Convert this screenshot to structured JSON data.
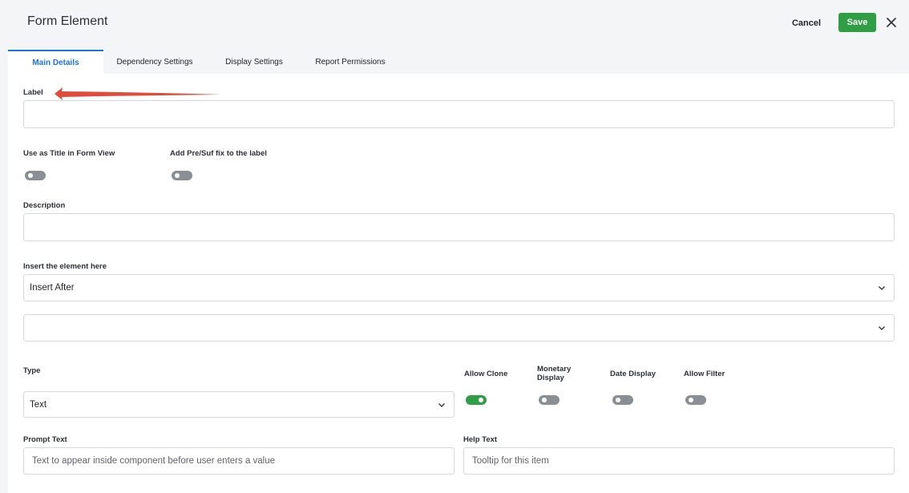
{
  "header": {
    "title": "Form Element",
    "cancel_label": "Cancel",
    "save_label": "Save",
    "close_icon": "close-icon"
  },
  "tabs": [
    {
      "label": "Main Details",
      "active": true
    },
    {
      "label": "Dependency Settings",
      "active": false
    },
    {
      "label": "Display Settings",
      "active": false
    },
    {
      "label": "Report Permissions",
      "active": false
    }
  ],
  "form": {
    "label": {
      "label": "Label",
      "value": ""
    },
    "use_as_title": {
      "label": "Use as Title in Form View",
      "on": false
    },
    "add_prefix_suffix": {
      "label": "Add Pre/Suf fix to the label",
      "on": false
    },
    "description": {
      "label": "Description",
      "value": ""
    },
    "insert": {
      "label": "Insert the element here",
      "value": "Insert After",
      "target_value": ""
    },
    "type": {
      "label": "Type",
      "value": "Text"
    },
    "allow_clone": {
      "label": "Allow Clone",
      "on": true
    },
    "monetary_display": {
      "label": "Monetary Display",
      "on": false
    },
    "date_display": {
      "label": "Date Display",
      "on": false
    },
    "allow_filter": {
      "label": "Allow Filter",
      "on": false
    },
    "prompt_text": {
      "label": "Prompt Text",
      "placeholder": "Text to appear inside component before user enters a value"
    },
    "help_text": {
      "label": "Help Text",
      "placeholder": "Tooltip for this item"
    }
  },
  "colors": {
    "accent": "#1a73e8",
    "save": "#2f9e44",
    "annotation_arrow": "#e04b3c"
  }
}
